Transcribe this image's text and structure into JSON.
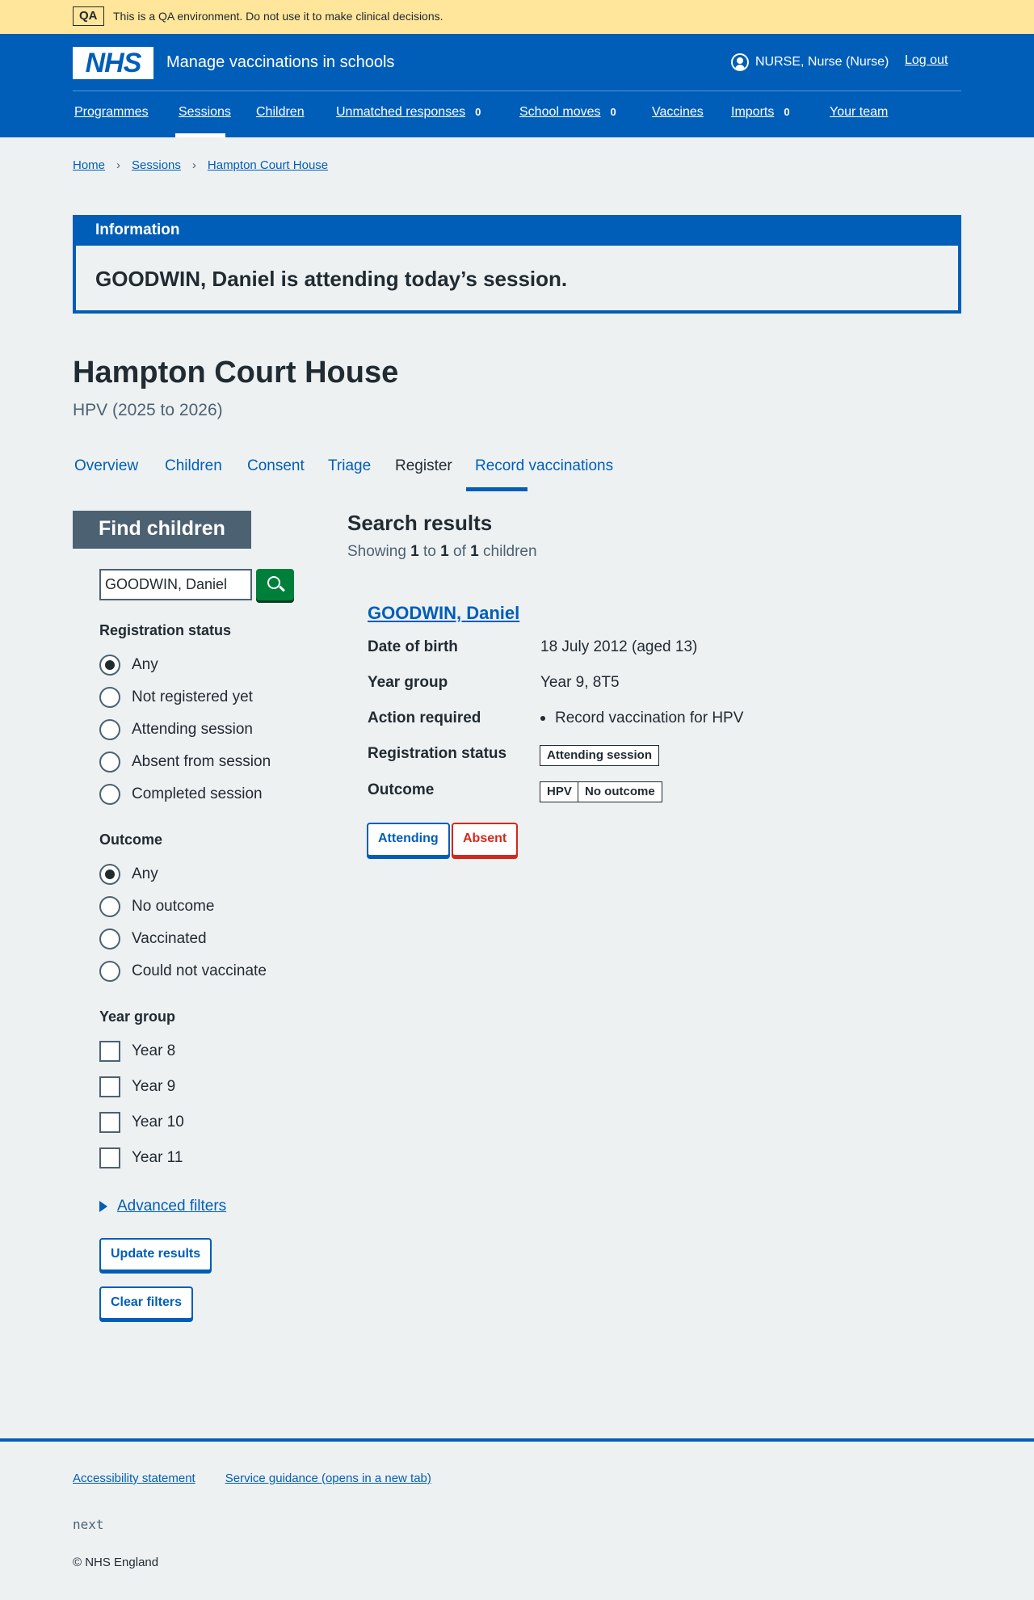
{
  "qa_banner": {
    "tag": "QA",
    "text": "This is a QA environment. Do not use it to make clinical decisions."
  },
  "header": {
    "logo": "NHS",
    "service_name": "Manage vaccinations in schools",
    "user_name": "NURSE, Nurse (Nurse)",
    "logout": "Log out",
    "nav": [
      {
        "label": "Programmes",
        "count": ""
      },
      {
        "label": "Sessions",
        "count": "",
        "active": true
      },
      {
        "label": "Children",
        "count": ""
      },
      {
        "label": "Unmatched responses",
        "count": "0"
      },
      {
        "label": "School moves",
        "count": "0"
      },
      {
        "label": "Vaccines",
        "count": ""
      },
      {
        "label": "Imports",
        "count": "0"
      },
      {
        "label": "Your team",
        "count": ""
      }
    ]
  },
  "breadcrumb": [
    "Home",
    "Sessions",
    "Hampton Court House"
  ],
  "information": {
    "heading": "Information",
    "message": "GOODWIN, Daniel is attending today’s session."
  },
  "page": {
    "title": "Hampton Court House",
    "caption": "HPV (2025 to 2026)"
  },
  "tabs": [
    "Overview",
    "Children",
    "Consent",
    "Triage",
    "Register",
    "Record vaccinations"
  ],
  "current_tab": "Register",
  "filters": {
    "title": "Find children",
    "search_value": "GOODWIN, Daniel",
    "registration": {
      "legend": "Registration status",
      "options": [
        "Any",
        "Not registered yet",
        "Attending session",
        "Absent from session",
        "Completed session"
      ],
      "selected": "Any"
    },
    "outcome": {
      "legend": "Outcome",
      "options": [
        "Any",
        "No outcome",
        "Vaccinated",
        "Could not vaccinate"
      ],
      "selected": "Any"
    },
    "year_group": {
      "legend": "Year group",
      "options": [
        "Year 8",
        "Year 9",
        "Year 10",
        "Year 11"
      ]
    },
    "advanced": "Advanced filters",
    "update": "Update results",
    "clear": "Clear filters"
  },
  "results": {
    "heading": "Search results",
    "showing_prefix": "Showing",
    "from": "1",
    "to_word": "to",
    "to": "1",
    "of_word": "of",
    "total": "1",
    "suffix": "children",
    "child": {
      "name": "GOODWIN, Daniel",
      "rows": {
        "dob_key": "Date of birth",
        "dob_val": "18 July 2012 (aged 13)",
        "year_key": "Year group",
        "year_val": "Year 9, 8T5",
        "action_key": "Action required",
        "action_val": "Record vaccination for HPV",
        "reg_key": "Registration status",
        "reg_tag": "Attending session",
        "outcome_key": "Outcome",
        "outcome_prog": "HPV",
        "outcome_tag": "No outcome"
      },
      "attending_btn": "Attending",
      "absent_btn": "Absent"
    }
  },
  "footer": {
    "links": [
      "Accessibility statement",
      "Service guidance (opens in a new tab)"
    ],
    "version": "next",
    "copyright": "© NHS England"
  }
}
